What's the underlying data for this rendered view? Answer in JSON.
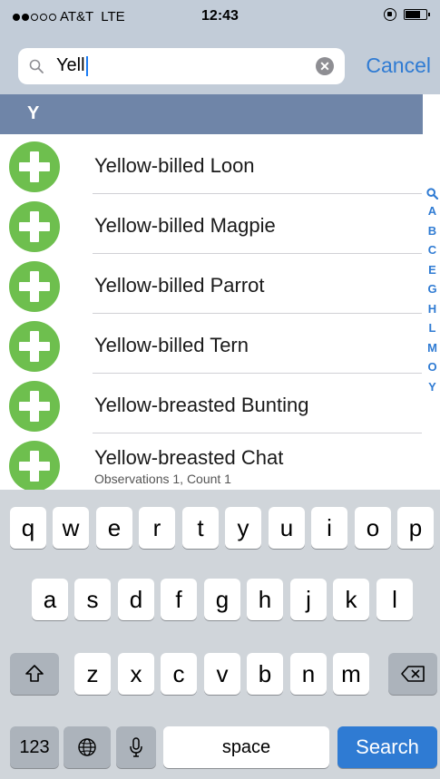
{
  "status_bar": {
    "carrier": "AT&T",
    "network": "LTE",
    "time": "12:43",
    "signal_bars_filled": 2,
    "signal_bars_total": 5,
    "battery_level": 0.75
  },
  "search": {
    "value": "Yell",
    "cancel_label": "Cancel"
  },
  "section": {
    "letter": "Y"
  },
  "list": {
    "items": [
      {
        "name": "Yellow-billed Loon",
        "subtitle": ""
      },
      {
        "name": "Yellow-billed Magpie",
        "subtitle": ""
      },
      {
        "name": "Yellow-billed Parrot",
        "subtitle": ""
      },
      {
        "name": "Yellow-billed Tern",
        "subtitle": ""
      },
      {
        "name": "Yellow-breasted Bunting",
        "subtitle": ""
      },
      {
        "name": "Yellow-breasted Chat",
        "subtitle": "Observations 1, Count 1"
      }
    ]
  },
  "index": {
    "letters": [
      "A",
      "B",
      "C",
      "E",
      "G",
      "H",
      "L",
      "M",
      "O",
      "Y"
    ]
  },
  "keyboard": {
    "row1": [
      "q",
      "w",
      "e",
      "r",
      "t",
      "y",
      "u",
      "i",
      "o",
      "p"
    ],
    "row2": [
      "a",
      "s",
      "d",
      "f",
      "g",
      "h",
      "j",
      "k",
      "l"
    ],
    "row3": [
      "z",
      "x",
      "c",
      "v",
      "b",
      "n",
      "m"
    ],
    "numbers_label": "123",
    "space_label": "space",
    "search_label": "Search"
  },
  "colors": {
    "accent": "#2f7bd3",
    "add_button": "#6ebf4e",
    "section_header": "#6f85a8"
  }
}
